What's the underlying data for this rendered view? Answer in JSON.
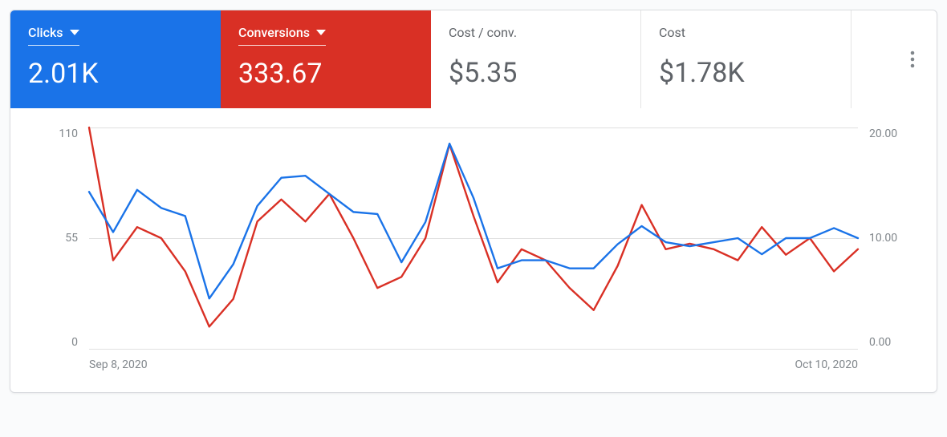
{
  "metrics": [
    {
      "key": "clicks",
      "label": "Clicks",
      "value": "2.01K",
      "variant": "blue",
      "dropdown": true
    },
    {
      "key": "conversions",
      "label": "Conversions",
      "value": "333.67",
      "variant": "red",
      "dropdown": true
    },
    {
      "key": "cost_conv",
      "label": "Cost / conv.",
      "value": "$5.35",
      "variant": "plain",
      "dropdown": false
    },
    {
      "key": "cost",
      "label": "Cost",
      "value": "$1.78K",
      "variant": "plain",
      "dropdown": false
    }
  ],
  "axes": {
    "left": {
      "ticks": [
        "110",
        "55",
        "0"
      ],
      "max": 110
    },
    "right": {
      "ticks": [
        "20.00",
        "10.00",
        "0.00"
      ],
      "max": 20
    },
    "x": {
      "start": "Sep 8, 2020",
      "end": "Oct 10, 2020"
    }
  },
  "colors": {
    "clicks": "#1a73e8",
    "conversions": "#d93025"
  },
  "chart_data": {
    "type": "line",
    "x_range": [
      "2020-09-08",
      "2020-10-10"
    ],
    "xlabel": "",
    "series": [
      {
        "name": "Clicks",
        "axis": "left",
        "ylim": [
          0,
          110
        ],
        "values": [
          78,
          58,
          79,
          70,
          66,
          25,
          42,
          71,
          85,
          86,
          77,
          68,
          67,
          43,
          63,
          102,
          75,
          40,
          44,
          44,
          40,
          40,
          52,
          61,
          53,
          51,
          53,
          55,
          47,
          55,
          55,
          60,
          55
        ]
      },
      {
        "name": "Conversions",
        "axis": "right",
        "ylim": [
          0,
          20
        ],
        "values": [
          20.0,
          8.0,
          11.0,
          10.0,
          7.0,
          2.0,
          4.5,
          11.5,
          13.5,
          11.5,
          14.0,
          10.0,
          5.5,
          6.5,
          10.0,
          18.5,
          12.0,
          6.0,
          9.0,
          8.0,
          5.5,
          3.5,
          7.5,
          13.0,
          9.0,
          9.5,
          9.0,
          8.0,
          11.0,
          8.5,
          10.0,
          7.0,
          9.0
        ]
      }
    ]
  }
}
